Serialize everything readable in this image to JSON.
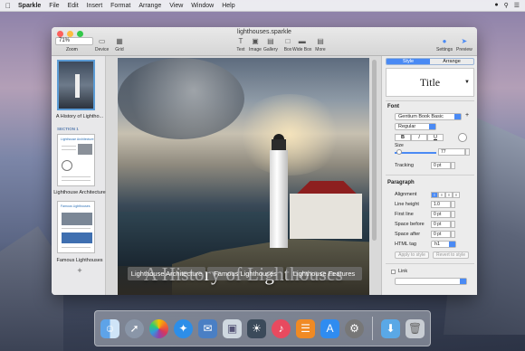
{
  "menubar": {
    "app_name": "Sparkle",
    "items": [
      "File",
      "Edit",
      "Insert",
      "Format",
      "Arrange",
      "View",
      "Window",
      "Help"
    ]
  },
  "window": {
    "title": "lighthouses.sparkle",
    "zoom_value": "71%",
    "toolbar": {
      "zoom": "Zoom",
      "device": "Device",
      "grid": "Grid",
      "text": "Text",
      "image": "Image",
      "gallery": "Gallery",
      "box": "Box",
      "widebox": "Wide Box",
      "more": "More",
      "settings": "Settings",
      "preview": "Preview"
    }
  },
  "sidebar": {
    "page1_label": "A History of Lightho...",
    "section_label": "SECTION 1",
    "page2_title": "Lighthouse Architecture",
    "page2_label": "Lighthouse Architecture",
    "page3_title": "Famous Lighthouses",
    "page3_label": "Famous Lighthouses",
    "add_symbol": "+"
  },
  "slide": {
    "title": "A History of Lighthouses",
    "buttons": [
      "Lighthouse Architecture",
      "Famous Lighthouses",
      "Lighthouse Features"
    ]
  },
  "inspector": {
    "tabs": {
      "style": "Style",
      "arrange": "Arrange"
    },
    "style_preview": "Title",
    "font_header": "Font",
    "font_family": "Gentium Book Basic",
    "font_weight": "Regular",
    "bold": "B",
    "italic": "I",
    "underline": "U",
    "size_label": "Size",
    "size_value": "77",
    "tracking_label": "Tracking",
    "tracking_value": "0 pt",
    "paragraph_header": "Paragraph",
    "alignment_label": "Alignment",
    "line_height_label": "Line height",
    "line_height_value": "1.0",
    "first_line_label": "First line",
    "first_line_value": "0 pt",
    "space_before_label": "Space before",
    "space_before_value": "0 pt",
    "space_after_label": "Space after",
    "space_after_value": "0 pt",
    "html_tag_label": "HTML tag",
    "html_tag_value": "h1",
    "apply_style": "Apply to style",
    "revert_style": "Revert to style",
    "link_label": "Link"
  },
  "dock": {
    "icons": [
      "finder-icon",
      "launchpad-icon",
      "photos-icon",
      "safari-icon",
      "mail-icon",
      "preview-icon",
      "photos-app-icon",
      "music-icon",
      "books-icon",
      "appstore-icon",
      "settings-icon",
      "downloads-icon",
      "trash-icon"
    ]
  },
  "colors": {
    "accent": "#4a8af4",
    "selection_border": "#5b9bd5"
  }
}
